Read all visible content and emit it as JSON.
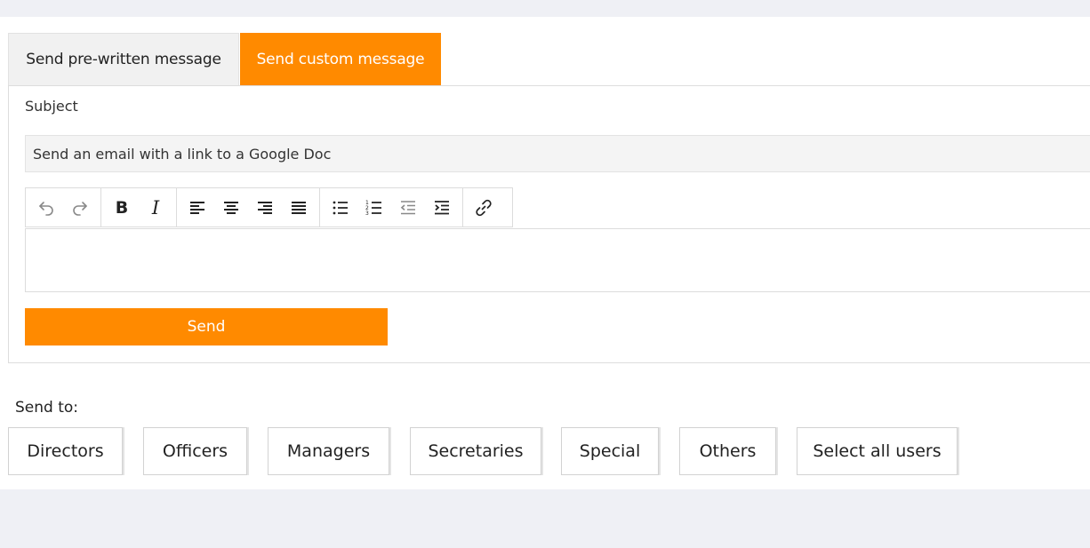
{
  "tabs": {
    "prewritten_label": "Send pre-written message",
    "custom_label": "Send custom message"
  },
  "form": {
    "subject_label": "Subject",
    "subject_value": "Send an email with a link to a Google Doc",
    "editor_value": "",
    "send_label": "Send"
  },
  "toolbar": {
    "groups": [
      [
        "undo-icon",
        "redo-icon"
      ],
      [
        "bold-icon",
        "italic-icon"
      ],
      [
        "align-left-icon",
        "align-center-icon",
        "align-right-icon",
        "align-justify-icon"
      ],
      [
        "bullet-list-icon",
        "numbered-list-icon",
        "outdent-icon",
        "indent-icon"
      ],
      [
        "link-icon"
      ]
    ]
  },
  "recipients": {
    "label": "Send to:",
    "groups": [
      "Directors",
      "Officers",
      "Managers",
      "Secretaries",
      "Special",
      "Others",
      "Select all users"
    ]
  },
  "colors": {
    "accent": "#ff8a00",
    "page_background": "#eff0f5"
  }
}
